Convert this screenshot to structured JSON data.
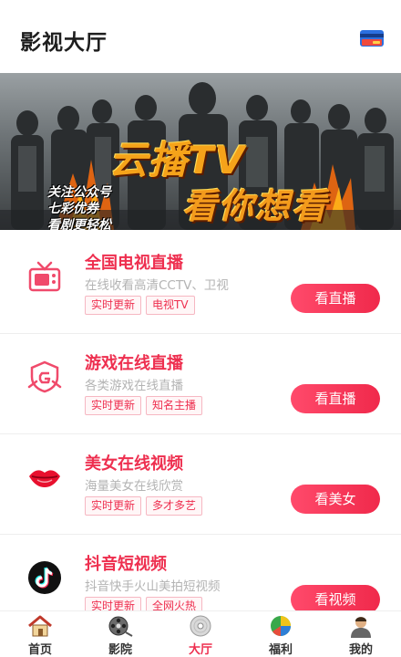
{
  "header": {
    "title": "影视大厅",
    "right_icon": "wallet-card-icon"
  },
  "banner": {
    "title": "云播TV",
    "slogan": "看你想看",
    "side_lines": [
      "关注公众号",
      "七彩优券",
      "看剧更轻松"
    ]
  },
  "items": [
    {
      "title": "全国电视直播",
      "desc": "在线收看高清CCTV、卫视",
      "tags": [
        "实时更新",
        "电视TV"
      ],
      "button": "看直播",
      "icon": "tv-icon",
      "color": "#ee2f4f"
    },
    {
      "title": "游戏在线直播",
      "desc": "各类游戏在线直播",
      "tags": [
        "实时更新",
        "知名主播"
      ],
      "button": "看直播",
      "icon": "game-shield-icon",
      "color": "#ee2f4f"
    },
    {
      "title": "美女在线视频",
      "desc": "海量美女在线欣赏",
      "tags": [
        "实时更新",
        "多才多艺"
      ],
      "button": "看美女",
      "icon": "lips-icon",
      "color": "#ee2f4f"
    },
    {
      "title": "抖音短视频",
      "desc": "抖音快手火山美拍短视频",
      "tags": [
        "实时更新",
        "全网火热"
      ],
      "button": "看视频",
      "icon": "tiktok-icon",
      "color": "#ee2f4f"
    }
  ],
  "tabbar": {
    "active": "大厅",
    "tabs": [
      {
        "label": "首页",
        "icon": "house-icon"
      },
      {
        "label": "影院",
        "icon": "film-reel-icon"
      },
      {
        "label": "大厅",
        "icon": "disc-icon"
      },
      {
        "label": "福利",
        "icon": "pie-icon"
      },
      {
        "label": "我的",
        "icon": "user-avatar-icon"
      }
    ]
  },
  "colors": {
    "accent": "#ee2f4f",
    "tag_border": "#f6b7c2",
    "desc_text": "#b3b3b3"
  }
}
